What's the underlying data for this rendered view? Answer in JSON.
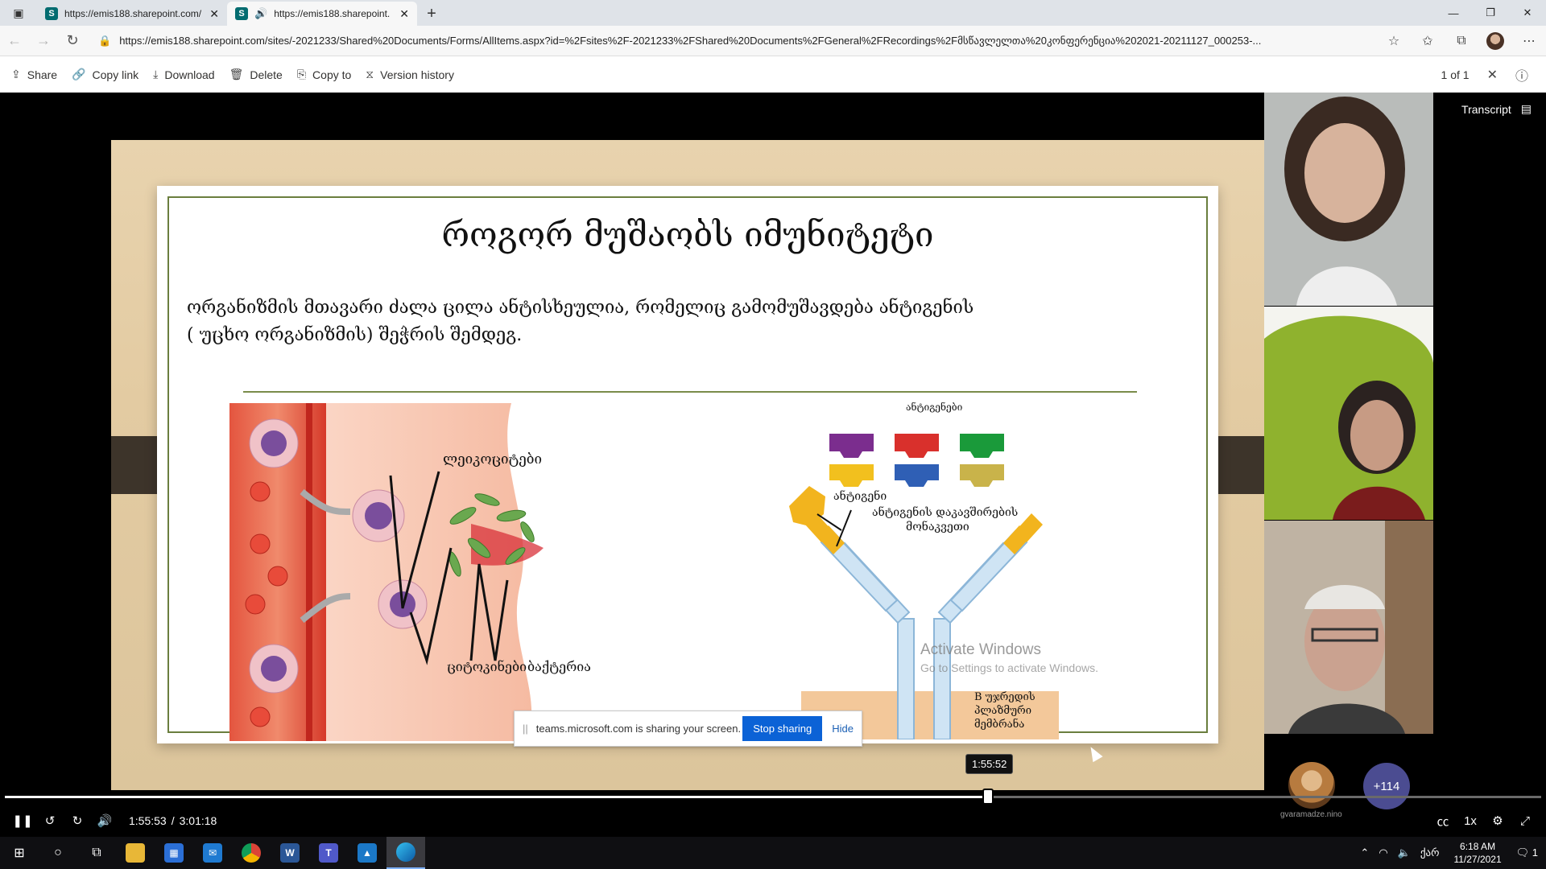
{
  "browser": {
    "tabs": [
      {
        "title": "https://emis188.sharepoint.com/",
        "favicon": "S",
        "active": false
      },
      {
        "title": "https://emis188.sharepoint.",
        "favicon": "S",
        "active": true,
        "audio": true
      }
    ],
    "new_tab": "+",
    "url": "https://emis188.sharepoint.com/sites/-2021233/Shared%20Documents/Forms/AllItems.aspx?id=%2Fsites%2F-2021233%2FShared%20Documents%2FGeneral%2FRecordings%2Fმსწავლელთა%20კონფერენცია%202021-20211127_000253-..."
  },
  "commands": {
    "share": "Share",
    "copy_link": "Copy link",
    "download": "Download",
    "delete": "Delete",
    "copy_to": "Copy to",
    "version_history": "Version history",
    "count": "1 of 1"
  },
  "slide": {
    "title": "როგორ მუშაობს იმუნიტეტი",
    "body_line1": "ორგანიზმის მთავარი ძალა  ცილა ანტისხეულია, რომელიც გამომუშავდება ანტიგენის",
    "body_line2": "( უცხო ორგანიზმის) შეჭრის შემდეგ.",
    "labels": {
      "leukocytes": "ლეიკოციტები",
      "cytokines": "ციტოკინები",
      "bacteria": "ბაქტერია",
      "antigens": "ანტიგენები",
      "antigen": "ანტიგენი",
      "binding_site_1": "ანტიგენის დაკავშირების",
      "binding_site_2": "მონაკვეთი",
      "bcell_1": "B უჯრედის",
      "bcell_2": "პლაზმური",
      "bcell_3": "მემბრანა"
    },
    "watermark_title": "Activate Windows",
    "watermark_sub": "Go to Settings to activate Windows."
  },
  "share_notice": {
    "message": "teams.microsoft.com is sharing your screen.",
    "stop": "Stop sharing",
    "hide": "Hide"
  },
  "player": {
    "transcript": "Transcript",
    "seek_tooltip": "1:55:52",
    "current_time": "1:55:53",
    "separator": "/",
    "duration": "3:01:18",
    "progress": 0.6397,
    "speed": "1x",
    "more_participants": "+114",
    "participant_name": "gvaramadze.nino"
  },
  "taskbar": {
    "time": "6:18 AM",
    "date": "11/27/2021",
    "lang": "ქარ",
    "notifications": "1"
  }
}
